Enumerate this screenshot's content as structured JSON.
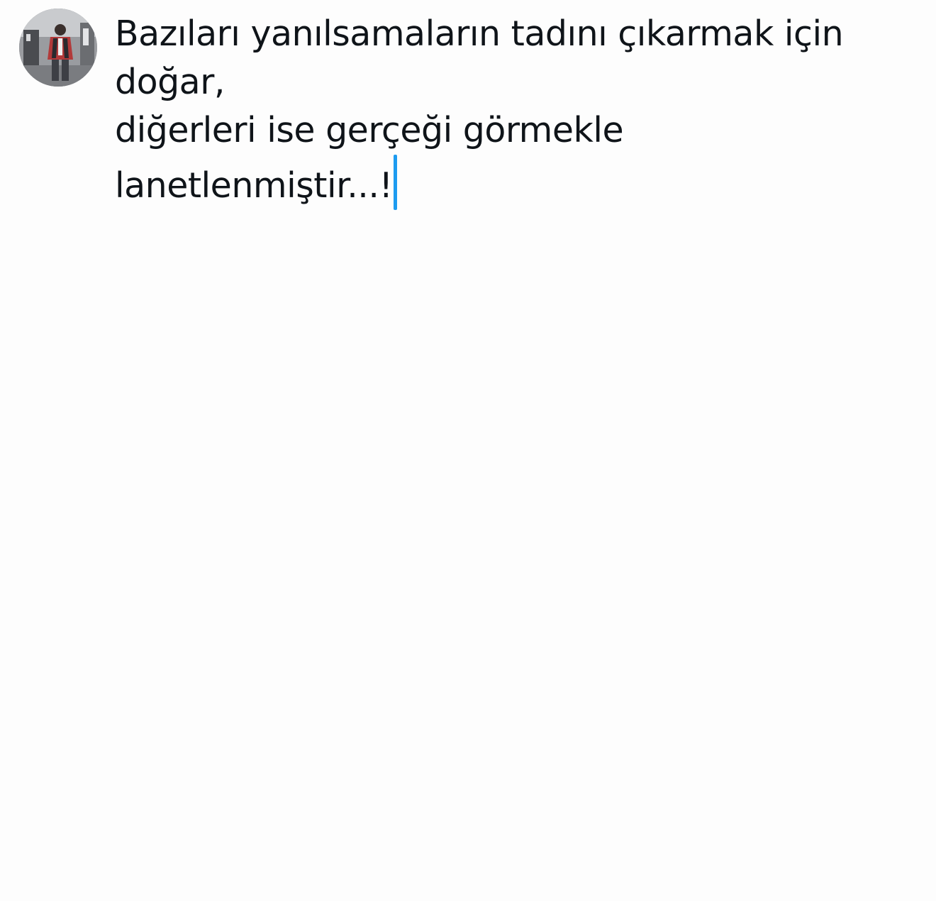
{
  "compose": {
    "avatar_alt": "profile photo",
    "text_lines": [
      "Bazıları yanılsamaların tadını çıkarmak için",
      "doğar,",
      "diğerleri ise gerçeği görmekle",
      "lanetlenmiştir...!"
    ],
    "caret_color": "#1d9bf0",
    "background_color": "#fdfdfd",
    "text_color": "#0f1419"
  }
}
